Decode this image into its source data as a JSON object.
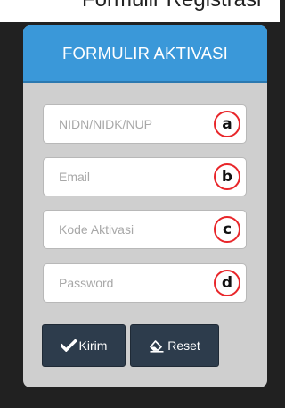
{
  "background_page": {
    "clipped_text": "Formulir Registrasi"
  },
  "card": {
    "title": "FORMULIR AKTIVASI",
    "fields": [
      {
        "placeholder": "NIDN/NIDK/NUP",
        "value": "",
        "marker": "a"
      },
      {
        "placeholder": "Email",
        "value": "",
        "marker": "b"
      },
      {
        "placeholder": "Kode Aktivasi",
        "value": "",
        "marker": "c"
      },
      {
        "placeholder": "Password",
        "value": "",
        "marker": "d"
      }
    ],
    "buttons": {
      "submit_label": "Kirim",
      "submit_icon": "check-icon",
      "reset_label": "Reset",
      "reset_icon": "eraser-icon"
    }
  },
  "colors": {
    "header": "#3a98d9",
    "card": "#cfcfcf",
    "button": "#2d3c4c",
    "marker": "#e8262a",
    "page_background": "#212121"
  }
}
